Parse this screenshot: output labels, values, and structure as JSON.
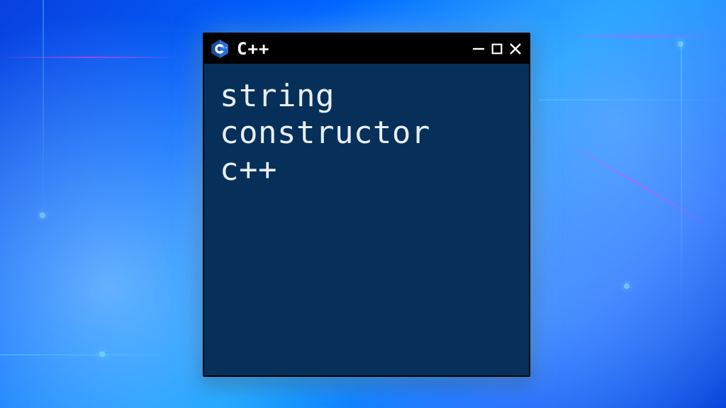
{
  "window": {
    "title": "C++",
    "body_text": "string\nconstructor\nc++"
  }
}
